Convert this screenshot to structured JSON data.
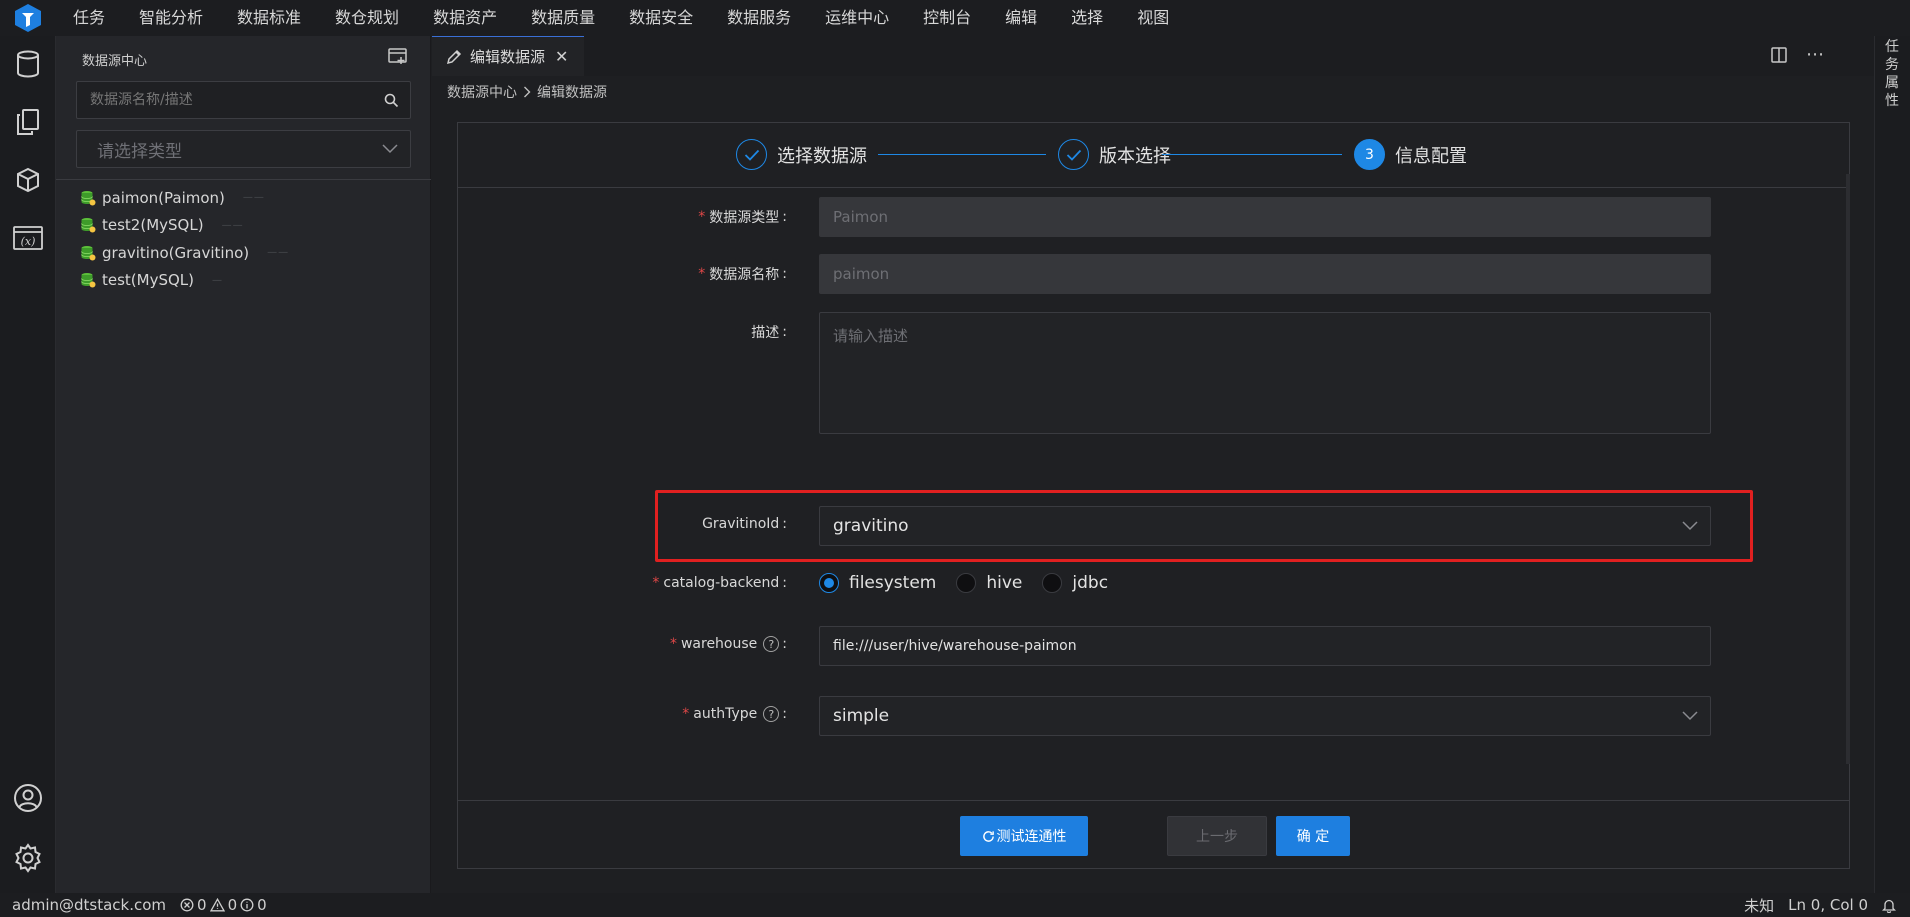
{
  "menu": [
    "任务",
    "智能分析",
    "数据标准",
    "数仓规划",
    "数据资产",
    "数据质量",
    "数据安全",
    "数据服务",
    "运维中心",
    "控制台",
    "编辑",
    "选择",
    "视图"
  ],
  "sidebar": {
    "title": "数据源中心",
    "search_placeholder": "数据源名称/描述",
    "type_placeholder": "请选择类型",
    "items": [
      {
        "label": "paimon(Paimon)"
      },
      {
        "label": "test2(MySQL)"
      },
      {
        "label": "gravitino(Gravitino)"
      },
      {
        "label": "test(MySQL)"
      }
    ]
  },
  "tab": {
    "label": "编辑数据源"
  },
  "breadcrumb": {
    "root": "数据源中心",
    "current": "编辑数据源"
  },
  "steps": [
    {
      "label": "选择数据源"
    },
    {
      "label": "版本选择"
    },
    {
      "number": "3",
      "label": "信息配置"
    }
  ],
  "form": {
    "type": {
      "label": "数据源类型",
      "value": "Paimon"
    },
    "name": {
      "label": "数据源名称",
      "value": "paimon"
    },
    "desc": {
      "label": "描述",
      "placeholder": "请输入描述"
    },
    "gravitino": {
      "label": "GravitinoId",
      "value": "gravitino"
    },
    "catalog": {
      "label": "catalog-backend",
      "options": [
        "filesystem",
        "hive",
        "jdbc"
      ],
      "selected": "filesystem"
    },
    "warehouse": {
      "label": "warehouse",
      "value": "file:///user/hive/warehouse-paimon"
    },
    "auth": {
      "label": "authType",
      "value": "simple"
    }
  },
  "buttons": {
    "test": "测试连通性",
    "prev": "上一步",
    "ok": "确 定"
  },
  "right_strip": {
    "label": "任务属性"
  },
  "status": {
    "user": "admin@dtstack.com",
    "errors": "0",
    "warnings": "0",
    "infos": "0",
    "lang": "未知",
    "position": "Ln 0, Col 0"
  },
  "colors": {
    "accent": "#1e88e5",
    "highlight": "#e02020",
    "required": "#e04848",
    "db_icon": "#5cc03a"
  }
}
